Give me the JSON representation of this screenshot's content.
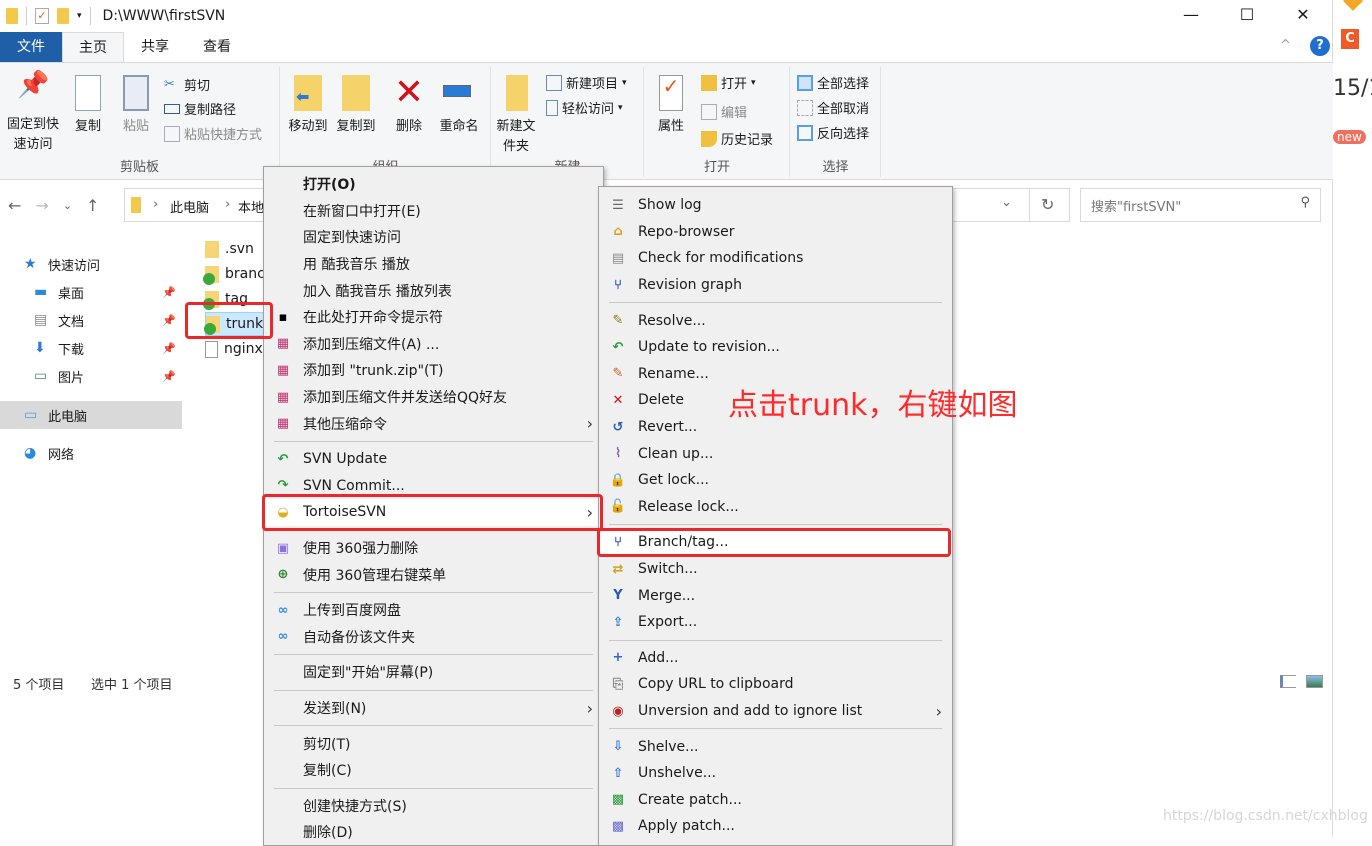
{
  "window": {
    "title": "D:\\WWW\\firstSVN",
    "minimize": "—",
    "maximize": "☐",
    "close": "✕"
  },
  "ribbon_tabs": [
    "文件",
    "主页",
    "共享",
    "查看"
  ],
  "ribbon": {
    "clipboard": {
      "label": "剪贴板",
      "pin": "固定到快速访问",
      "copy": "复制",
      "paste": "粘贴",
      "cut": "剪切",
      "copy_path": "复制路径",
      "paste_shortcut": "粘贴快捷方式"
    },
    "organize": {
      "label": "组织",
      "move_to": "移动到",
      "copy_to": "复制到",
      "delete": "删除",
      "rename": "重命名"
    },
    "new": {
      "label": "新建",
      "new_folder": "新建文件夹",
      "new_item": "新建项目",
      "easy_access": "轻松访问"
    },
    "open": {
      "label": "打开",
      "properties": "属性",
      "open": "打开",
      "edit": "编辑",
      "history": "历史记录"
    },
    "select": {
      "label": "选择",
      "select_all": "全部选择",
      "select_none": "全部取消",
      "invert": "反向选择"
    }
  },
  "address": {
    "crumbs": [
      "此电脑",
      "本地"
    ],
    "search_placeholder": "搜索\"firstSVN\""
  },
  "nav": [
    {
      "label": "快速访问",
      "icon": "star-icon"
    },
    {
      "label": "桌面",
      "icon": "desktop-icon",
      "pinned": true
    },
    {
      "label": "文档",
      "icon": "documents-icon",
      "pinned": true
    },
    {
      "label": "下载",
      "icon": "download-icon",
      "pinned": true
    },
    {
      "label": "图片",
      "icon": "pictures-icon",
      "pinned": true
    },
    {
      "label": "此电脑",
      "icon": "computer-icon",
      "selected": true
    },
    {
      "label": "网络",
      "icon": "network-icon"
    }
  ],
  "files": [
    ".svn",
    "branches",
    "tag",
    "trunk",
    "nginx"
  ],
  "status": {
    "count": "5 个项目",
    "selected": "选中 1 个项目"
  },
  "context_menu": [
    {
      "label": "打开(O)",
      "bold": true
    },
    {
      "label": "在新窗口中打开(E)"
    },
    {
      "label": "固定到快速访问"
    },
    {
      "label": "用 酷我音乐 播放"
    },
    {
      "label": "加入 酷我音乐 播放列表"
    },
    {
      "label": "在此处打开命令提示符",
      "icon": "cmd"
    },
    {
      "label": "添加到压缩文件(A) ...",
      "icon": "rar"
    },
    {
      "label": "添加到 \"trunk.zip\"(T)",
      "icon": "rar"
    },
    {
      "label": "添加到压缩文件并发送给QQ好友",
      "icon": "rar"
    },
    {
      "label": "其他压缩命令",
      "icon": "rar",
      "submenu": true
    },
    {
      "sep": true
    },
    {
      "label": "SVN Update",
      "icon": "svn-update"
    },
    {
      "label": "SVN Commit...",
      "icon": "svn-commit"
    },
    {
      "label": "TortoiseSVN",
      "icon": "tortoise",
      "submenu": true,
      "highlighted": true
    },
    {
      "sep": true
    },
    {
      "label": "使用 360强力删除",
      "icon": "360-shred"
    },
    {
      "label": "使用 360管理右键菜单",
      "icon": "360-plus"
    },
    {
      "sep": true
    },
    {
      "label": "上传到百度网盘",
      "icon": "baidu"
    },
    {
      "label": "自动备份该文件夹",
      "icon": "baidu"
    },
    {
      "sep": true
    },
    {
      "label": "固定到\"开始\"屏幕(P)"
    },
    {
      "sep": true
    },
    {
      "label": "发送到(N)",
      "submenu": true
    },
    {
      "sep": true
    },
    {
      "label": "剪切(T)"
    },
    {
      "label": "复制(C)"
    },
    {
      "sep": true
    },
    {
      "label": "创建快捷方式(S)"
    },
    {
      "label": "删除(D)"
    }
  ],
  "svn_menu": [
    {
      "label": "Show log",
      "icon": "log"
    },
    {
      "label": "Repo-browser",
      "icon": "repo"
    },
    {
      "label": "Check for modifications",
      "icon": "check"
    },
    {
      "label": "Revision graph",
      "icon": "graph"
    },
    {
      "sep": true
    },
    {
      "label": "Resolve...",
      "icon": "resolve"
    },
    {
      "label": "Update to revision...",
      "icon": "update"
    },
    {
      "label": "Rename...",
      "icon": "rename"
    },
    {
      "label": "Delete",
      "icon": "delete"
    },
    {
      "label": "Revert...",
      "icon": "revert"
    },
    {
      "label": "Clean up...",
      "icon": "cleanup"
    },
    {
      "label": "Get lock...",
      "icon": "lock"
    },
    {
      "label": "Release lock...",
      "icon": "unlock"
    },
    {
      "sep": true
    },
    {
      "label": "Branch/tag...",
      "icon": "branch",
      "highlighted": true
    },
    {
      "label": "Switch...",
      "icon": "switch"
    },
    {
      "label": "Merge...",
      "icon": "merge"
    },
    {
      "label": "Export...",
      "icon": "export"
    },
    {
      "sep": true
    },
    {
      "label": "Add...",
      "icon": "add"
    },
    {
      "label": "Copy URL to clipboard",
      "icon": "copy-url"
    },
    {
      "label": "Unversion and add to ignore list",
      "icon": "ignore",
      "submenu": true
    },
    {
      "sep": true
    },
    {
      "label": "Shelve...",
      "icon": "shelve"
    },
    {
      "label": "Unshelve...",
      "icon": "unshelve"
    },
    {
      "label": "Create patch...",
      "icon": "patch"
    },
    {
      "label": "Apply patch...",
      "icon": "apply-patch"
    }
  ],
  "annotation": "点击trunk，右键如图",
  "watermark": "https://blog.csdn.net/cxhblog",
  "side_window": {
    "logo": "C",
    "date": "15/1",
    "badge": "new"
  },
  "colors": {
    "accent": "#1e5fa8",
    "highlight_red": "#e8282a",
    "annotation": "#ff2a2a"
  }
}
